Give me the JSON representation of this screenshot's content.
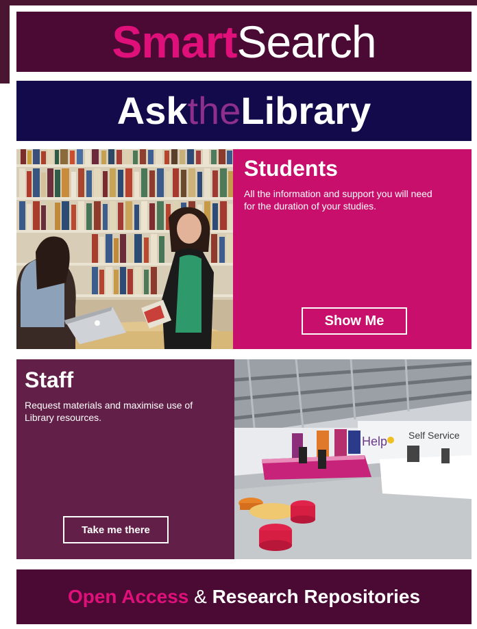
{
  "smartsearch": {
    "part1": "Smart",
    "part2": "Search",
    "color_accent": "#e0107a",
    "color_bg": "#4a0a34"
  },
  "ask_the_library": {
    "part1": "Ask",
    "part2": "the",
    "part3": "Library",
    "color_bg": "#130a4c",
    "color_accent": "#8e2f8c"
  },
  "students": {
    "title": "Students",
    "description": "All the information and support you will need for the duration of your studies.",
    "button_label": "Show Me",
    "photo": "library-bookshelves-students-photo",
    "color_bg": "#c80f6b"
  },
  "staff": {
    "title": "Staff",
    "description": "Request materials and maximise use of Library resources.",
    "button_label": "Take me there",
    "photo": "library-help-desk-photo",
    "photo_sign_help": "Help",
    "photo_sign_self_service": "Self Service",
    "color_bg": "#621f47"
  },
  "open_access": {
    "part1": "Open Access",
    "part2": " & ",
    "part3": "Research Repositories",
    "color_accent": "#e0107a",
    "color_bg": "#4a0a34"
  }
}
